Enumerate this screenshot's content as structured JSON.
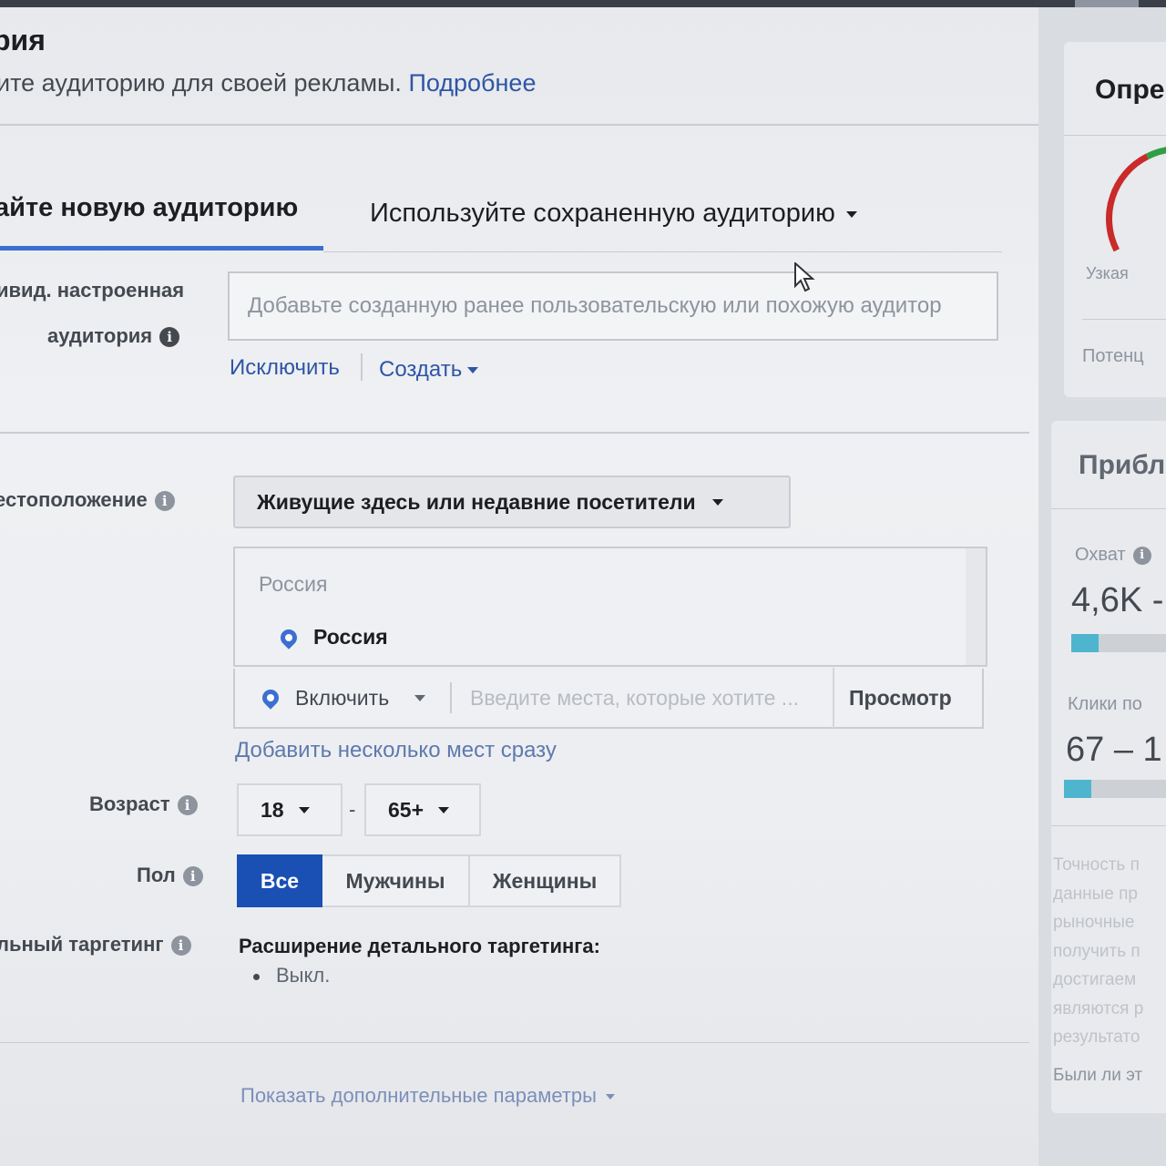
{
  "header": {
    "title": "рия",
    "subtitle": "ите аудиторию для своей рекламы.",
    "learn_more": "Подробнее"
  },
  "tabs": [
    {
      "label": "айте новую аудиторию",
      "active": true
    },
    {
      "label": "Используйте сохраненную аудиторию",
      "active": false
    }
  ],
  "custom_audience": {
    "label_line1": "ивид. настроенная",
    "label_line2": "аудитория",
    "placeholder": "Добавьте созданную ранее пользовательскую или похожую аудитор",
    "exclude": "Исключить",
    "create": "Создать"
  },
  "location": {
    "label": "естоположение",
    "type_selected": "Живущие здесь или недавние посетители",
    "group_header": "Россия",
    "selected_items": [
      "Россия"
    ],
    "include_label": "Включить",
    "search_placeholder": "Введите места, которые хотите ...",
    "browse": "Просмотр",
    "bulk_add": "Добавить несколько мест сразу"
  },
  "age": {
    "label": "Возраст",
    "min": "18",
    "separator": "-",
    "max": "65+"
  },
  "gender": {
    "label": "Пол",
    "options": [
      "Все",
      "Мужчины",
      "Женщины"
    ],
    "selected": "Все"
  },
  "detailed_targeting": {
    "label": "льный таргетинг",
    "expansion_title": "Расширение детального таргетинга:",
    "expansion_value": "Выкл."
  },
  "more_options": "Показать дополнительные параметры",
  "right_panel": {
    "card1_title": "Опре",
    "gauge_label": "Узкая",
    "potential": "Потенц",
    "card2_title": "Прибл",
    "reach_label": "Охват",
    "reach_value": "4,6K -",
    "reach_fill": 0.25,
    "clicks_label": "Клики по",
    "clicks_value": "67 – 1",
    "clicks_fill": 0.25,
    "disclaimer_lines": [
      "Точность п",
      "данные пр",
      "рыночные",
      "получить п",
      "достигаем",
      "являются р",
      "результато"
    ],
    "feedback": "Были ли эт"
  },
  "colors": {
    "accent": "#3b6fd1",
    "link": "#2f55a4",
    "selected_button": "#1a4fb4",
    "reach_bar": "#4fb5cf"
  }
}
